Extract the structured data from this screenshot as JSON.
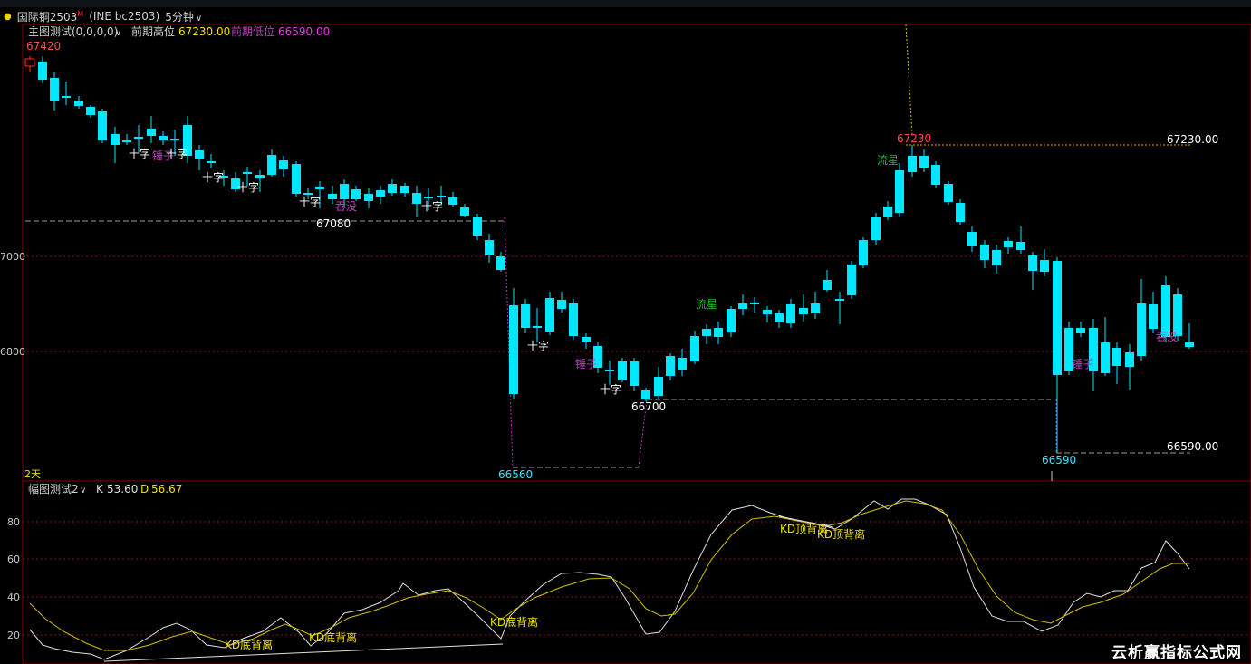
{
  "title_bar": {
    "instrument": "国际铜2503",
    "marker": "M",
    "code": "(INE bc2503)",
    "period": "5分钟"
  },
  "main_panel": {
    "indicator_name": "主图测试(0,0,0,0)",
    "prev_high_label": "前期高位",
    "prev_high_value": "67230.00",
    "prev_low_label": "前期低位",
    "prev_low_value": "66590.00",
    "y_axis_labels": [
      "7000",
      "6800"
    ],
    "day_marker": "2天",
    "price_annotations": [
      {
        "text": "67420",
        "color": "#ff4a4a"
      },
      {
        "text": "67080",
        "color": "#ffffff"
      },
      {
        "text": "66700",
        "color": "#ffffff"
      },
      {
        "text": "66560",
        "color": "#40e0ff"
      },
      {
        "text": "67230",
        "color": "#ff4a4a"
      },
      {
        "text": "66590",
        "color": "#40e0ff"
      },
      {
        "text": "67230.00",
        "color": "#ffffff"
      },
      {
        "text": "66590.00",
        "color": "#ffffff"
      }
    ],
    "pattern_labels": [
      {
        "text": "十字",
        "color": "#ffffff"
      },
      {
        "text": "锤子",
        "color": "#c040c0"
      },
      {
        "text": "十字",
        "color": "#ffffff"
      },
      {
        "text": "十字",
        "color": "#ffffff"
      },
      {
        "text": "十字",
        "color": "#ffffff"
      },
      {
        "text": "十字",
        "color": "#ffffff"
      },
      {
        "text": "吞没",
        "color": "#c040c0"
      },
      {
        "text": "十字",
        "color": "#ffffff"
      },
      {
        "text": "十字",
        "color": "#ffffff"
      },
      {
        "text": "锤子",
        "color": "#c040c0"
      },
      {
        "text": "十字",
        "color": "#ffffff"
      },
      {
        "text": "流星",
        "color": "#20c020"
      },
      {
        "text": "流星",
        "color": "#20c020"
      },
      {
        "text": "锤子",
        "color": "#c040c0"
      },
      {
        "text": "吞没",
        "color": "#c040c0"
      }
    ]
  },
  "sub_panel": {
    "indicator_name": "幅图测试2",
    "k_label": "K",
    "k_value": "53.60",
    "d_label": "D",
    "d_value": "56.67",
    "y_axis_labels": [
      "80",
      "60",
      "40",
      "20"
    ],
    "divergence_labels": [
      "KD底背离",
      "KD底背离",
      "KD底背离",
      "KD顶背离",
      "KD顶背离"
    ]
  },
  "watermark": "云析赢指标公式网",
  "colors": {
    "up_candle": "#ff3030",
    "down_candle": "#00e8ff",
    "grid_dash": "#8a1010",
    "k_line": "#e0e0e0",
    "d_line": "#d0c000",
    "prev_high_line": "#f0a000",
    "panel_border": "#800000"
  }
}
